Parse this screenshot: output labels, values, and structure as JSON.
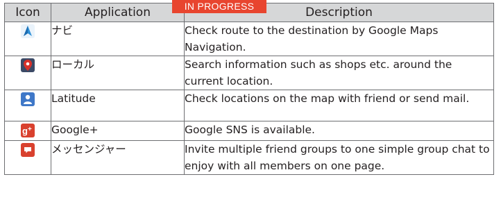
{
  "badge": "IN PROGRESS",
  "table": {
    "headers": {
      "icon": "Icon",
      "application": "Application",
      "description": "Description"
    },
    "rows": [
      {
        "icon": "navigation-icon",
        "application": "ナビ",
        "description": "Check route to the destination by Google Maps Navigation."
      },
      {
        "icon": "local-places-icon",
        "application": "ローカル",
        "description": "Search information such as shops etc. around the current location."
      },
      {
        "icon": "latitude-icon",
        "application": "Latitude",
        "description": "Check locations on the map with friend or send mail."
      },
      {
        "icon": "google-plus-icon",
        "application": "Google+",
        "description": "Google SNS is available."
      },
      {
        "icon": "messenger-icon",
        "application": "メッセンジャー",
        "description": "Invite multiple friend groups to one simple group chat to enjoy with all members on one page."
      }
    ]
  },
  "colors": {
    "header_bg": "#d6d7d8",
    "border": "#6d6e71",
    "badge_bg": "#e8452f"
  }
}
